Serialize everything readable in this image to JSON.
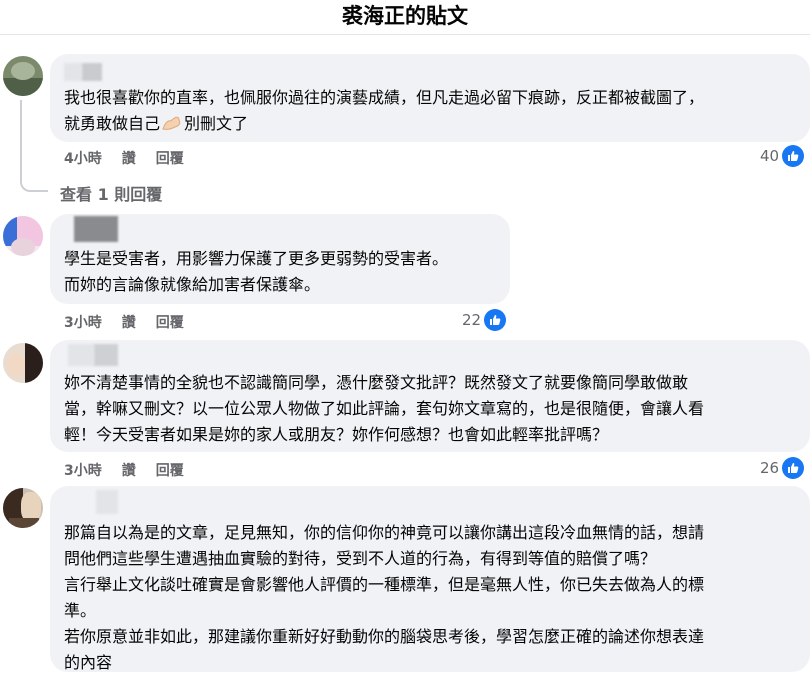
{
  "header": {
    "title": "裘海正的貼文"
  },
  "comments": [
    {
      "text": "我也很喜歡你的直率，也佩服你過往的演藝成績，但凡走過必留下痕跡，反正都被截圖了，\n就勇敢做自己",
      "text_tail": "別刪文了",
      "emoji": "💪",
      "time": "4小時",
      "like_label": "讚",
      "reply_label": "回覆",
      "reactions": "40",
      "view_replies": "查看 1 則回覆"
    },
    {
      "text": "學生是受害者，用影響力保護了更多更弱勢的受害者。\n而妳的言論像就像給加害者保護傘。",
      "time": "3小時",
      "like_label": "讚",
      "reply_label": "回覆",
      "reactions": "22"
    },
    {
      "text": "妳不清楚事情的全貌也不認識簡同學，憑什麼發文批評？既然發文了就要像簡同學敢做敢\n當，幹嘛又刪文？以一位公眾人物做了如此評論，套句妳文章寫的，也是很隨便，會讓人看\n輕！今天受害者如果是妳的家人或朋友？妳作何感想？也會如此輕率批評嗎？",
      "time": "3小時",
      "like_label": "讚",
      "reply_label": "回覆",
      "reactions": "26"
    },
    {
      "text": "那篇自以為是的文章，足見無知，你的信仰你的神竟可以讓你講出這段冷血無情的話，想請\n問他們這些學生遭遇抽血實驗的對待，受到不人道的行為，有得到等值的賠償了嗎？\n言行舉止文化談吐確實是會影響他人評價的一種標準，但是毫無人性，你已失去做為人的標\n準。\n若你原意並非如此，那建議你重新好好動動你的腦袋思考後，學習怎麼正確的論述你想表達\n的內容"
    }
  ],
  "colors": {
    "like_blue": "#1877f2",
    "bubble_bg": "#f0f2f5",
    "meta_gray": "#65676b"
  }
}
